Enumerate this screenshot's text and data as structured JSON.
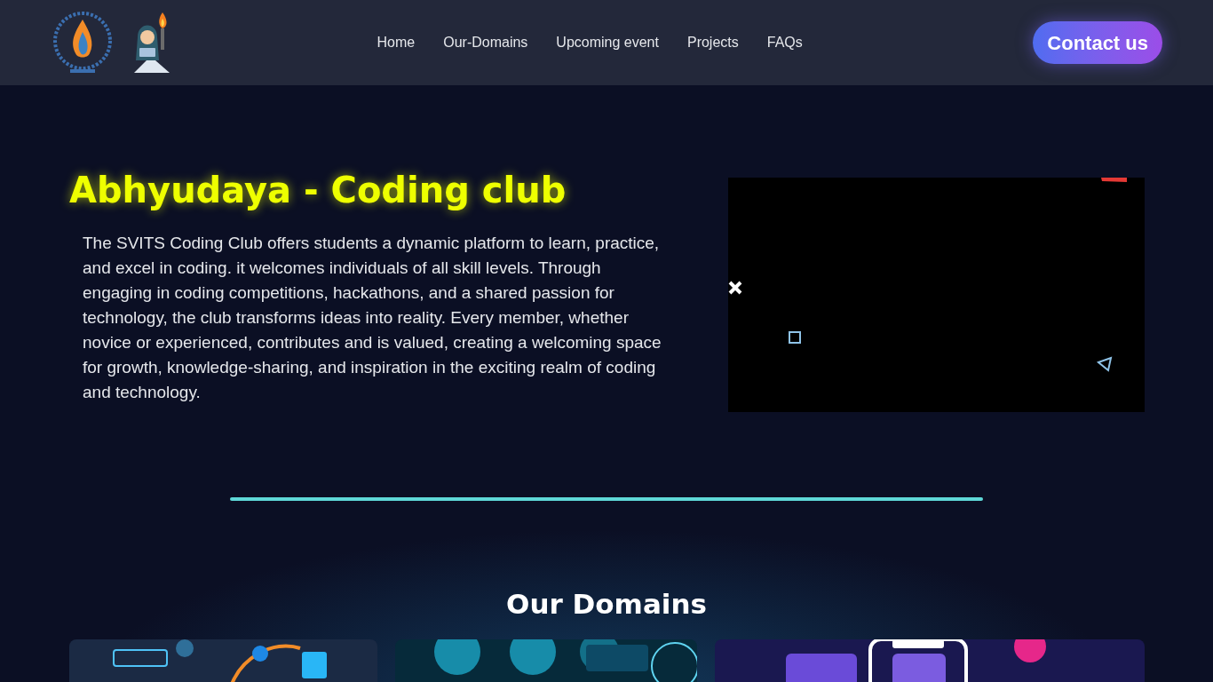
{
  "nav": {
    "links": [
      "Home",
      "Our-Domains",
      "Upcoming event",
      "Projects",
      "FAQs"
    ],
    "contact_button": "Contact us"
  },
  "hero": {
    "title": "Abhyudaya - Coding club",
    "description": "The SVITS Coding Club offers students a dynamic platform to learn, practice, and excel in coding. it welcomes individuals of all skill levels. Through engaging in coding competitions, hackathons, and a shared passion for technology, the club transforms ideas into reality. Every member, whether novice or experienced, contributes and is valued, creating a welcoming space for growth, knowledge-sharing, and inspiration in the exciting realm of coding and technology."
  },
  "domains": {
    "title": "Our Domains"
  }
}
